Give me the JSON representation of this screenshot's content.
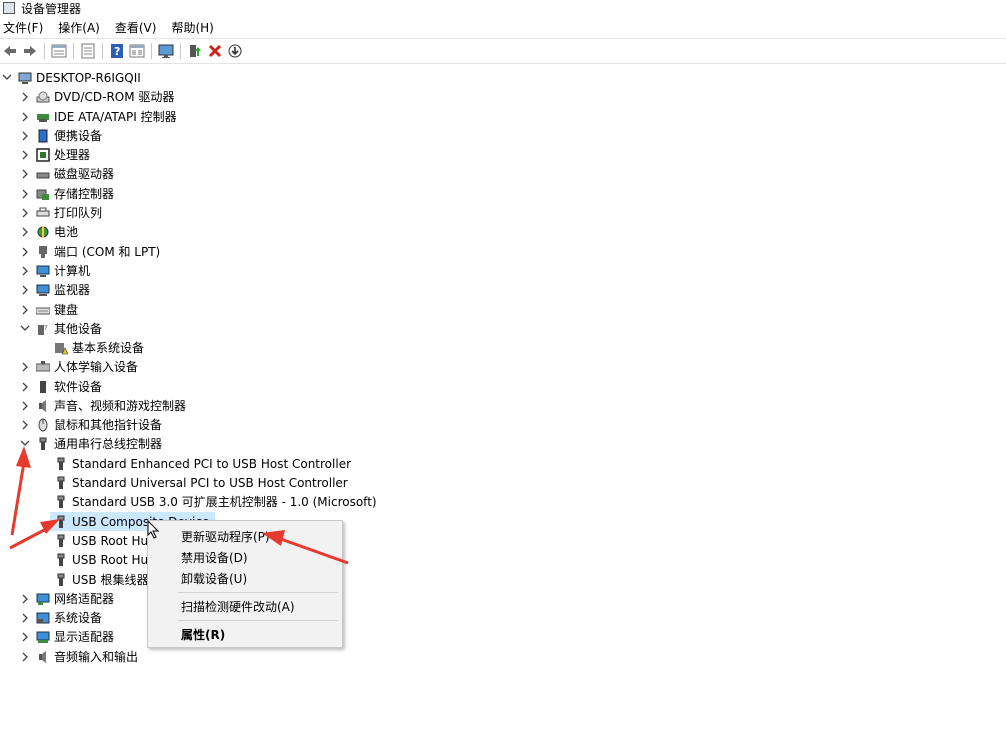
{
  "window": {
    "title": "设备管理器"
  },
  "menubar": {
    "items": [
      "文件(F)",
      "操作(A)",
      "查看(V)",
      "帮助(H)"
    ]
  },
  "toolbar": {
    "buttons": [
      "back-icon",
      "forward-icon",
      "properties-icon",
      "list-icon",
      "help-icon",
      "view-icon",
      "monitor-icon",
      "update-driver-icon",
      "remove-icon",
      "download-icon"
    ]
  },
  "tree": {
    "root": "DESKTOP-R6IGQII",
    "items": [
      {
        "label": "DVD/CD-ROM 驱动器",
        "icon": "dvd-drive-icon"
      },
      {
        "label": "IDE ATA/ATAPI 控制器",
        "icon": "ide-controller-icon"
      },
      {
        "label": "便携设备",
        "icon": "portable-device-icon"
      },
      {
        "label": "处理器",
        "icon": "processor-icon"
      },
      {
        "label": "磁盘驱动器",
        "icon": "disk-drive-icon"
      },
      {
        "label": "存储控制器",
        "icon": "storage-controller-icon"
      },
      {
        "label": "打印队列",
        "icon": "printer-icon"
      },
      {
        "label": "电池",
        "icon": "battery-icon"
      },
      {
        "label": "端口 (COM 和 LPT)",
        "icon": "port-icon"
      },
      {
        "label": "计算机",
        "icon": "computer-icon"
      },
      {
        "label": "监视器",
        "icon": "monitor-icon"
      },
      {
        "label": "键盘",
        "icon": "keyboard-icon"
      },
      {
        "label": "其他设备",
        "icon": "other-devices-icon"
      },
      {
        "label": "基本系统设备",
        "icon": "warning-device-icon"
      },
      {
        "label": "人体学输入设备",
        "icon": "hid-icon"
      },
      {
        "label": "软件设备",
        "icon": "software-device-icon"
      },
      {
        "label": "声音、视频和游戏控制器",
        "icon": "sound-icon"
      },
      {
        "label": "鼠标和其他指针设备",
        "icon": "mouse-icon"
      },
      {
        "label": "通用串行总线控制器",
        "icon": "usb-icon"
      },
      {
        "label": "Standard Enhanced PCI to USB Host Controller",
        "icon": "usb-plug-icon"
      },
      {
        "label": "Standard Universal PCI to USB Host Controller",
        "icon": "usb-plug-icon"
      },
      {
        "label": "Standard USB 3.0 可扩展主机控制器 - 1.0 (Microsoft)",
        "icon": "usb-plug-icon"
      },
      {
        "label": "USB Composite Device",
        "icon": "usb-plug-icon"
      },
      {
        "label": "USB Root Hub",
        "icon": "usb-plug-icon"
      },
      {
        "label": "USB Root Hub",
        "icon": "usb-plug-icon"
      },
      {
        "label": "USB 根集线器",
        "icon": "usb-plug-icon"
      },
      {
        "label": "网络适配器",
        "icon": "network-adapter-icon"
      },
      {
        "label": "系统设备",
        "icon": "system-device-icon"
      },
      {
        "label": "显示适配器",
        "icon": "display-adapter-icon"
      },
      {
        "label": "音频输入和输出",
        "icon": "audio-icon"
      }
    ]
  },
  "context_menu": {
    "items": [
      "更新驱动程序(P)",
      "禁用设备(D)",
      "卸载设备(U)",
      "扫描检测硬件改动(A)",
      "属性(R)"
    ]
  },
  "colors": {
    "selection": "#cce8ff",
    "annotation_arrow": "#e8392f"
  }
}
